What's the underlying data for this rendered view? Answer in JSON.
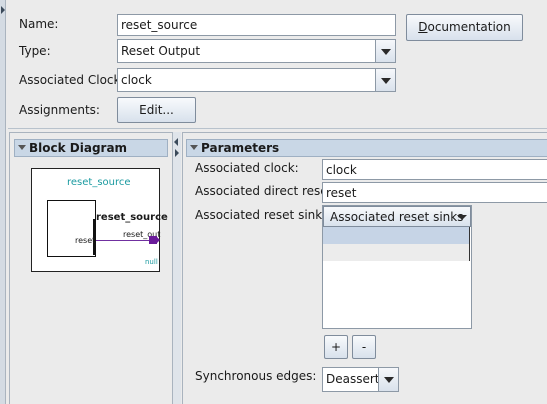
{
  "form": {
    "name_label": "Name:",
    "name_value": "reset_source",
    "type_label": "Type:",
    "type_value": "Reset Output",
    "clock_label": "Associated Clock:",
    "clock_value": "clock",
    "assignments_label": "Assignments:",
    "edit_button": "Edit...",
    "documentation_button_first": "D",
    "documentation_button_rest": "ocumentation"
  },
  "block_diagram": {
    "header": "Block Diagram",
    "module_title": "reset_source",
    "block_name": "reset_source",
    "input_port": "reset",
    "output_port": "reset_out",
    "null_label": "null",
    "accent_color": "#1a9aa0",
    "wire_color": "#7030a0"
  },
  "parameters": {
    "header": "Parameters",
    "assoc_clock_label": "Associated clock:",
    "assoc_clock_value": "clock",
    "assoc_direct_reset_label": "Associated direct reset:",
    "assoc_direct_reset_value": "reset",
    "assoc_reset_sinks_label": "Associated reset sinks:",
    "assoc_reset_sinks_dropdown": "Associated reset sinks",
    "add_button": "+",
    "remove_button": "-",
    "sync_edges_label": "Synchronous edges:",
    "sync_edges_value": "Deassert"
  }
}
